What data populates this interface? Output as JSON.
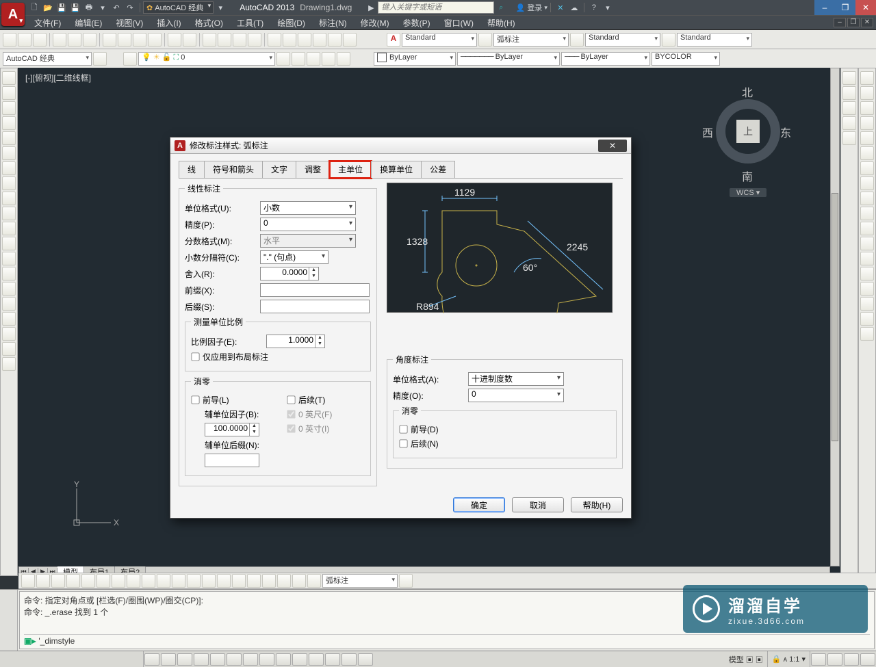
{
  "qat": {
    "workspace_combo": "AutoCAD 经典",
    "app_name": "AutoCAD 2013",
    "doc_name": "Drawing1.dwg",
    "search_placeholder": "键入关键字或短语",
    "login": "登录"
  },
  "menu": [
    "文件(F)",
    "编辑(E)",
    "视图(V)",
    "插入(I)",
    "格式(O)",
    "工具(T)",
    "绘图(D)",
    "标注(N)",
    "修改(M)",
    "参数(P)",
    "窗口(W)",
    "帮助(H)"
  ],
  "tool_row1": {
    "style1": "Standard",
    "style2": "弧标注",
    "style3": "Standard",
    "style4": "Standard"
  },
  "tool_row2": {
    "workspace": "AutoCAD 经典",
    "zero": "0",
    "layer_combo": "0",
    "c1": "ByLayer",
    "c2": "ByLayer",
    "c3": "ByLayer",
    "c4": "BYCOLOR"
  },
  "viewport": {
    "label": "[-][俯视][二维线框]",
    "nav": {
      "n": "北",
      "s": "南",
      "e": "东",
      "w": "西",
      "top": "上",
      "wcs": "WCS ▾"
    },
    "ucs": {
      "x": "X",
      "y": "Y"
    }
  },
  "tabs": {
    "model": "模型",
    "layout1": "布局1",
    "layout2": "布局2"
  },
  "dimtb": {
    "style": "弧标注"
  },
  "cmd": {
    "line1": "命令: 指定对角点或 [栏选(F)/圈围(WP)/圈交(CP)]:",
    "line2": "命令: _.erase 找到 1 个",
    "input": "'_dimstyle"
  },
  "dialog": {
    "title": "修改标注样式: 弧标注",
    "tabs": [
      "线",
      "符号和箭头",
      "文字",
      "调整",
      "主单位",
      "换算单位",
      "公差"
    ],
    "active_tab": 4,
    "linear": {
      "legend": "线性标注",
      "unit_format_label": "单位格式(U):",
      "unit_format": "小数",
      "precision_label": "精度(P):",
      "precision": "0",
      "fraction_label": "分数格式(M):",
      "fraction": "水平",
      "decsep_label": "小数分隔符(C):",
      "decsep": "\".\"  (句点)",
      "round_label": "舍入(R):",
      "round": "0.0000",
      "prefix_label": "前缀(X):",
      "prefix": "",
      "suffix_label": "后缀(S):",
      "suffix": ""
    },
    "scale": {
      "legend": "测量单位比例",
      "factor_label": "比例因子(E):",
      "factor": "1.0000",
      "layout_only": "仅应用到布局标注"
    },
    "zero": {
      "legend": "消零",
      "leading": "前导(L)",
      "trailing": "后续(T)",
      "sub_factor_label": "辅单位因子(B):",
      "sub_factor": "100.0000",
      "feet": "0 英尺(F)",
      "inches": "0 英寸(I)",
      "sub_suffix_label": "辅单位后缀(N):",
      "sub_suffix": ""
    },
    "preview": {
      "d1": "1129",
      "d2": "1328",
      "d3": "2245",
      "ang": "60°",
      "rad": "R894"
    },
    "angular": {
      "legend": "角度标注",
      "unit_label": "单位格式(A):",
      "unit": "十进制度数",
      "prec_label": "精度(O):",
      "prec": "0",
      "zero_legend": "消零",
      "leading": "前导(D)",
      "trailing": "后续(N)"
    },
    "buttons": {
      "ok": "确定",
      "cancel": "取消",
      "help": "帮助(H)"
    }
  },
  "watermark": {
    "t1": "溜溜自学",
    "t2": "zixue.3d66.com"
  }
}
